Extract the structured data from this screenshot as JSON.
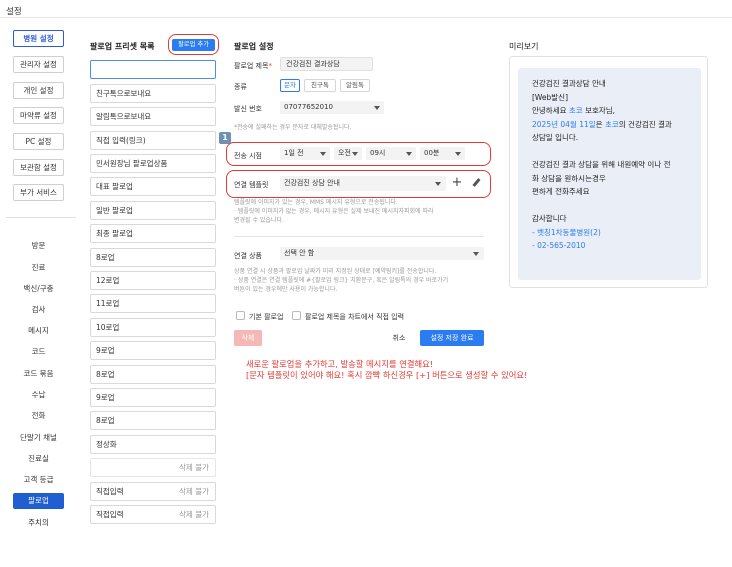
{
  "page_title": "설정",
  "nav": {
    "top_buttons": [
      "병원 설정",
      "관리자 설정",
      "개인 설정",
      "마약류 설정",
      "PC 설정",
      "보관함 설정",
      "부가 서비스"
    ],
    "active_top": "병원 설정",
    "items": [
      "방문",
      "진료",
      "백신/구충",
      "검사",
      "메시지",
      "코드",
      "코드 묶음",
      "수납",
      "전화",
      "단말기 채널",
      "진료실",
      "고객 등급",
      "팔로업",
      "주치의"
    ],
    "active_item": "팔로업"
  },
  "presets": {
    "title": "팔로업 프리셋 목록",
    "add_button": "팔로업 추가",
    "search_value": "",
    "items": [
      {
        "label": "친구톡으로보내요",
        "right": ""
      },
      {
        "label": "알림톡으로보내요",
        "right": ""
      },
      {
        "label": "직접 입력(링크)",
        "right": ""
      },
      {
        "label": "민서원장님 팔로업상품",
        "right": ""
      },
      {
        "label": "대표 팔로업",
        "right": ""
      },
      {
        "label": "일반 팔로업",
        "right": ""
      },
      {
        "label": "최종 팔로업",
        "right": ""
      },
      {
        "label": "8로업",
        "right": ""
      },
      {
        "label": "12로업",
        "right": ""
      },
      {
        "label": "11로업",
        "right": ""
      },
      {
        "label": "10로업",
        "right": ""
      },
      {
        "label": "9로업",
        "right": ""
      },
      {
        "label": "8로업",
        "right": ""
      },
      {
        "label": "9로업",
        "right": ""
      },
      {
        "label": "8로업",
        "right": ""
      },
      {
        "label": "정상화",
        "right": ""
      },
      {
        "label": "",
        "right": "삭제 불가"
      },
      {
        "label": "직접입력",
        "right": "삭제 불가"
      },
      {
        "label": "직접입력",
        "right": "삭제 불가"
      }
    ]
  },
  "settings": {
    "title": "팔로업 설정",
    "name_label": "팔로업 제목",
    "name_required": "*",
    "name_value": "건강검진 결과상담",
    "type_label": "종류",
    "types": [
      "문자",
      "친구톡",
      "알림톡"
    ],
    "active_type": "문자",
    "sender_label": "발신 번호",
    "sender_value": "07077652010",
    "sender_hint": "*전송에 실패하는 경우 문자로 대체발송됩니다.",
    "badge_number": "1",
    "send_time_label": "전송 시점",
    "send_time": [
      "1일 전",
      "오전",
      "09시",
      "00분"
    ],
    "template_label": "연결 템플릿",
    "template_value": "건강검진 상담 안내",
    "template_hint": "템플릿에 이미지가 있는 경우, MMS 메시지 유형으로 전송됩니다.\n· 템플릿에 이미지가 없는 경우, 메시지 유형은 실제 보내진 메시지자피회에 따라\n변경될 수 있습니다.",
    "product_label": "연결 상품",
    "product_value": "선택 안 함",
    "product_hint": "상품 연결 시 상품과 팔로업 날짜가 미리 지정된 상태로 [예약팀키]를 전송합니다.\n· 상품 연결은 연결 템플릿에 #{팔로업 링크} 치환문구, 혹은 알림톡의 경우 바로가기\n버튼이 있는 경우에만 사용이 가능합니다.",
    "default_followup": "기본 팔로업",
    "direct_input": "팔로업 제목을 차트에서 직접 입력",
    "delete_button": "삭제",
    "cancel_button": "취소",
    "save_button": "설정 저장 완료"
  },
  "notice": {
    "line1": "새로운 팔로업을 추가하고, 발송할 메시지를 연결해요!",
    "line2": "[문자 템플릿이 있어야 해요! 혹시 깜빡 하신경우 [+] 버튼으로 생성할 수 있어요!"
  },
  "preview": {
    "title": "미리보기",
    "lines": [
      {
        "parts": [
          {
            "t": "건강검진 결과상담 안내",
            "c": ""
          }
        ]
      },
      {
        "parts": [
          {
            "t": "[Web발신]",
            "c": ""
          }
        ]
      },
      {
        "parts": [
          {
            "t": "안녕하세요 ",
            "c": ""
          },
          {
            "t": "초코",
            "c": "blue"
          },
          {
            "t": " 보호자님,",
            "c": ""
          }
        ]
      },
      {
        "parts": [
          {
            "t": "2025년 04월 11일",
            "c": "blue"
          },
          {
            "t": "은 ",
            "c": ""
          },
          {
            "t": "초코",
            "c": "blue"
          },
          {
            "t": "의 건강검진 결과",
            "c": ""
          }
        ]
      },
      {
        "parts": [
          {
            "t": "상담일 입니다.",
            "c": ""
          }
        ]
      },
      {
        "parts": [
          {
            "t": "",
            "c": ""
          }
        ]
      },
      {
        "parts": [
          {
            "t": "건강검진 결과 상담을 위해 내원예약 이나 전",
            "c": ""
          }
        ]
      },
      {
        "parts": [
          {
            "t": "화 상담을 원하시는경우",
            "c": ""
          }
        ]
      },
      {
        "parts": [
          {
            "t": "편하게 전화주세요",
            "c": ""
          }
        ]
      },
      {
        "parts": [
          {
            "t": "",
            "c": ""
          }
        ]
      },
      {
        "parts": [
          {
            "t": "감사합니다",
            "c": ""
          }
        ]
      },
      {
        "parts": [
          {
            "t": "- 벳칭1차동물병원(2)",
            "c": "blue"
          }
        ]
      },
      {
        "parts": [
          {
            "t": "- 02-565-2010",
            "c": "blue"
          }
        ]
      }
    ]
  },
  "colors": {
    "accent": "#2b7cf0",
    "nav_active": "#1f5fd1",
    "annotation": "#e53935"
  }
}
